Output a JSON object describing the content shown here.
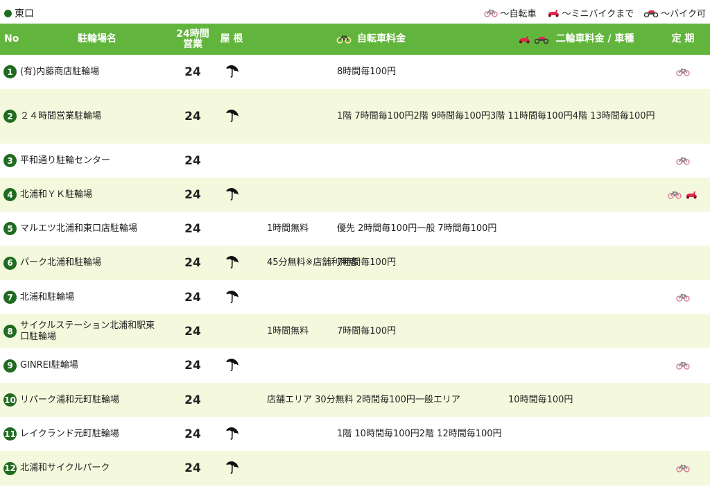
{
  "section": {
    "title": "東口"
  },
  "legend": [
    {
      "icon": "bicycle-icon",
      "label": "〜自転車"
    },
    {
      "icon": "scooter-icon",
      "label": "〜ミニバイクまで"
    },
    {
      "icon": "motorbike-icon",
      "label": "〜バイク可"
    }
  ],
  "header": {
    "no": "No",
    "name": "駐輪場名",
    "hours_line1": "24時間",
    "hours_line2": "営業",
    "roof": "屋 根",
    "bike_fee": "自転車料金",
    "moto_fee": "二輪車料金 / 車種",
    "pass": "定 期"
  },
  "rows": [
    {
      "no": "1",
      "name": "(有)内藤商店駐輪場",
      "hours": "24",
      "roof": true,
      "note": [],
      "fee": [
        "8時間毎100円"
      ],
      "pass": [
        "bicycle"
      ]
    },
    {
      "no": "2",
      "name": "２４時間営業駐輪場",
      "hours": "24",
      "roof": true,
      "note": [],
      "fee": [
        "1階 7時間毎100円",
        "2階 9時間毎100円",
        "3階 11時間毎100円",
        "4階 13時間毎100円"
      ],
      "pass": []
    },
    {
      "no": "3",
      "name": "平和通り駐輪センター",
      "hours": "24",
      "roof": false,
      "note": [],
      "fee": [],
      "pass": [
        "bicycle"
      ]
    },
    {
      "no": "4",
      "name": "北浦和ＹＫ駐輪場",
      "hours": "24",
      "roof": true,
      "note": [],
      "fee": [],
      "pass": [
        "bicycle",
        "scooter"
      ]
    },
    {
      "no": "5",
      "name": "マルエツ北浦和東口店駐輪場",
      "hours": "24",
      "roof": false,
      "note": [
        "1時間無料"
      ],
      "fee": [
        "優先 2時間毎100円",
        "一般 7時間毎100円"
      ],
      "pass": []
    },
    {
      "no": "6",
      "name": "パーク北浦和駐輪場",
      "hours": "24",
      "roof": true,
      "note": [
        "45分無料",
        "※店舗利用客"
      ],
      "fee": [
        "7時間毎100円"
      ],
      "pass": []
    },
    {
      "no": "7",
      "name": "北浦和駐輪場",
      "hours": "24",
      "roof": true,
      "note": [],
      "fee": [],
      "pass": [
        "bicycle"
      ]
    },
    {
      "no": "8",
      "name": "サイクルステーション北浦和駅東口駐輪場",
      "hours": "24",
      "roof": false,
      "note": [
        "1時間無料"
      ],
      "fee": [
        "7時間毎100円"
      ],
      "pass": []
    },
    {
      "no": "9",
      "name": "GINREI駐輪場",
      "hours": "24",
      "roof": true,
      "note": [],
      "fee": [],
      "pass": [
        "bicycle"
      ]
    },
    {
      "no": "10",
      "name": "リパーク浦和元町駐輪場",
      "hours": "24",
      "roof": false,
      "note": [
        "店舗エリア 30分無料 2時間毎100円",
        "一般エリア 　　　　　10時間毎100円"
      ],
      "fee": [],
      "pass": []
    },
    {
      "no": "11",
      "name": "レイクランド元町駐輪場",
      "hours": "24",
      "roof": true,
      "note": [],
      "fee": [
        "1階 10時間毎100円",
        "2階 12時間毎100円"
      ],
      "pass": []
    },
    {
      "no": "12",
      "name": "北浦和サイクルパーク",
      "hours": "24",
      "roof": true,
      "note": [],
      "fee": [],
      "pass": [
        "bicycle"
      ]
    }
  ],
  "colors": {
    "header_bg": "#62b53c",
    "row_alt_bg": "#f4f9dd",
    "number_badge": "#1f6b1f",
    "scooter": "#e0284f",
    "motorbike": "#e0284f"
  }
}
